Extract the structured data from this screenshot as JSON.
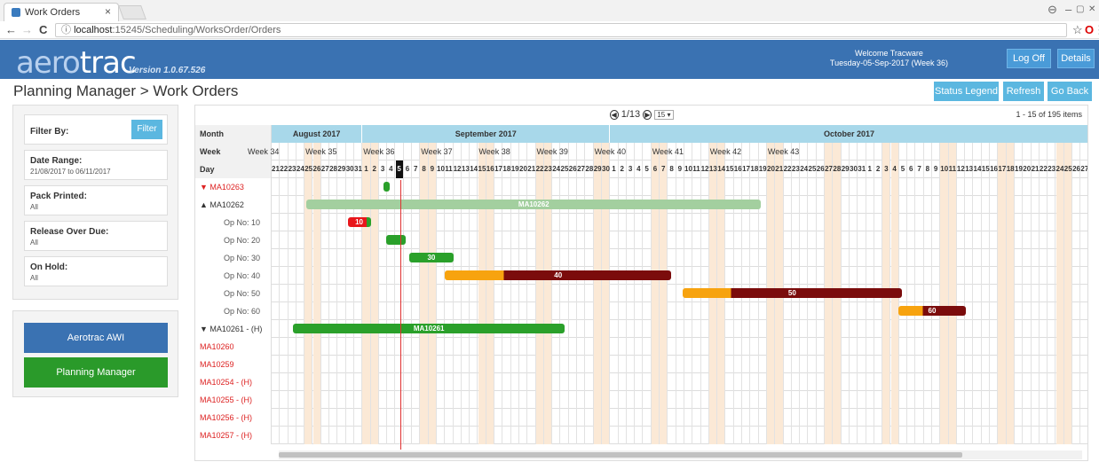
{
  "browser": {
    "tab_title": "Work Orders",
    "url_host": "localhost",
    "url_path": ":15245/Scheduling/WorksOrder/Orders",
    "min": "–",
    "max": "▢",
    "close": "✕",
    "back": "←",
    "forward": "→",
    "reload": "C",
    "info": "ⓘ",
    "star": "☆",
    "opera": "O",
    "menu": "⋮",
    "profile": "⊖",
    "tab_close": "×"
  },
  "app": {
    "logo_a": "aero",
    "logo_b": "trac",
    "version": "Version 1.0.67.526",
    "welcome": "Welcome Tracware",
    "date": "Tuesday-05-Sep-2017 (Week 36)",
    "logoff": "Log Off",
    "details": "Details"
  },
  "page": {
    "title": "Planning Manager > Work Orders",
    "status_legend": "Status Legend",
    "refresh": "Refresh",
    "go_back": "Go Back"
  },
  "filters": {
    "filter_by": "Filter By:",
    "filter_button": "Filter",
    "items": [
      {
        "title": "Date Range:",
        "value": "21/08/2017 to 06/11/2017"
      },
      {
        "title": "Pack Printed:",
        "value": "All"
      },
      {
        "title": "Release Over Due:",
        "value": "All"
      },
      {
        "title": "On Hold:",
        "value": "All"
      }
    ]
  },
  "nav": {
    "awi": "Aerotrac AWI",
    "planning": "Planning Manager"
  },
  "gantt": {
    "pager": "1/13",
    "page_size": "15 ▾",
    "items_info": "1 - 15 of 195 items",
    "prev": "◀",
    "next": "▶",
    "headers": {
      "month": "Month",
      "week": "Week",
      "day": "Day"
    },
    "months": [
      "August 2017",
      "September 2017",
      "October 2017"
    ],
    "weeks": [
      "Week 34",
      "Week 35",
      "Week 36",
      "Week 37",
      "Week 38",
      "Week 39",
      "Week 40",
      "Week 41",
      "Week 42",
      "Week 43"
    ],
    "rows": [
      "▼ MA10263",
      "▲ MA10262",
      "Op No: 10",
      "Op No: 20",
      "Op No: 30",
      "Op No: 40",
      "Op No: 50",
      "Op No: 60",
      "▼ MA10261 - (H)",
      "MA10260",
      "MA10259",
      "MA10254 - (H)",
      "MA10255 - (H)",
      "MA10256 - (H)",
      "MA10257 - (H)"
    ],
    "bar_labels": {
      "ma10262": "MA10262",
      "op10": "10",
      "op30": "30",
      "op40": "40",
      "op50": "50",
      "op60": "60",
      "ma10261": "MA10261"
    },
    "today_day": "5"
  },
  "colors": {
    "appbar": "#3a72b2",
    "green": "#2aa02a",
    "red": "#e8161b",
    "orange": "#f7a30f",
    "darkred": "#7b0c0c",
    "lightgreen": "#a3cf9f",
    "month": "#a8d8ea"
  }
}
